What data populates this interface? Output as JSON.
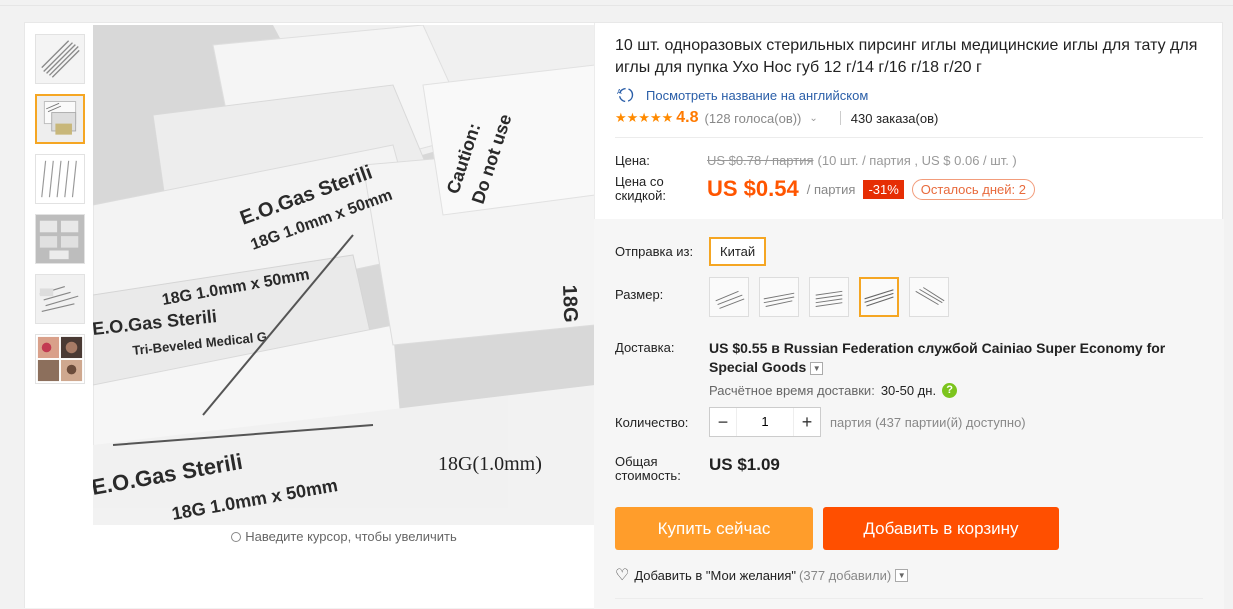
{
  "product": {
    "title": "10 шт. одноразовых стерильных пирсинг иглы медицинские иглы для тату для иглы для пупка Ухо Нос губ 12 г/14 г/16 г/18 г/20 г",
    "translate_link": "Посмотреть название на английском",
    "rating_score": "4.8",
    "stars": "★★★★★",
    "votes": "(128 голоса(ов))",
    "orders": "430 заказа(ов)"
  },
  "gallery": {
    "zoom_hint": "Наведите курсор, чтобы увеличить",
    "main_caption": "18G(1.0mm)",
    "active_thumb_index": 1,
    "thumb_count": 6
  },
  "price": {
    "label": "Цена:",
    "old": "US $0.78 / партия",
    "old_rest": "(10 шт. / партия , US $ 0.06 / шт. )",
    "discount_label": "Цена со скидкой:",
    "new": "US $0.54",
    "per": "/ партия",
    "percent": "-31%",
    "days_left": "Осталось дней: 2"
  },
  "ship_from": {
    "label": "Отправка из:",
    "value": "Китай"
  },
  "size": {
    "label": "Размер:",
    "count": 5,
    "selected_index": 3
  },
  "delivery": {
    "label": "Доставка:",
    "price": "US $0.55",
    "text_a": " в ",
    "text_b": "Russian Federation службой Cainiao Super Economy for Special Goods",
    "eta_label": "Расчётное время доставки:",
    "eta_value": "30-50 дн."
  },
  "quantity": {
    "label": "Количество:",
    "minus": "−",
    "value": "1",
    "plus": "+",
    "available": "партия (437 партии(й) доступно)"
  },
  "total": {
    "label": "Общая стоимость:",
    "value": "US $1.09"
  },
  "buttons": {
    "buy": "Купить сейчас",
    "cart": "Добавить в корзину"
  },
  "wishlist": {
    "label": "Добавить в \"Мои желания\"",
    "count": "(377 добавили)"
  },
  "colors": {
    "accent_orange": "#ff5500",
    "buy": "#ff9d2b",
    "cart": "#ff4f00",
    "selected_border": "#f5a623"
  }
}
